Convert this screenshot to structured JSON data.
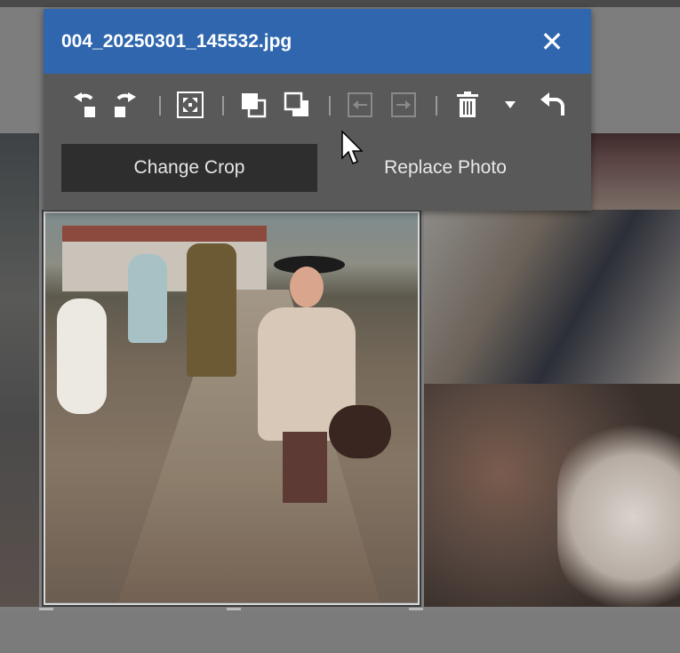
{
  "dialog": {
    "title": "004_20250301_145532.jpg",
    "close_glyph": "✕",
    "toolbar": [
      {
        "name": "rotate-left-icon",
        "enabled": true
      },
      {
        "name": "rotate-right-icon",
        "enabled": true
      },
      {
        "name": "fit-frame-icon",
        "enabled": true
      },
      {
        "name": "bring-forward-icon",
        "enabled": true
      },
      {
        "name": "send-backward-icon",
        "enabled": true
      },
      {
        "name": "move-left-icon",
        "enabled": false
      },
      {
        "name": "move-right-icon",
        "enabled": false
      },
      {
        "name": "delete-icon",
        "enabled": true
      },
      {
        "name": "dropdown-arrow-icon",
        "enabled": true
      },
      {
        "name": "undo-icon",
        "enabled": true
      }
    ],
    "change_crop_label": "Change Crop",
    "replace_photo_label": "Replace Photo"
  },
  "colors": {
    "titlebar": "#2f66ae",
    "dialog_bg": "#595959",
    "active_tab": "#2e2e2e",
    "canvas_bg": "#7d7d7d"
  }
}
